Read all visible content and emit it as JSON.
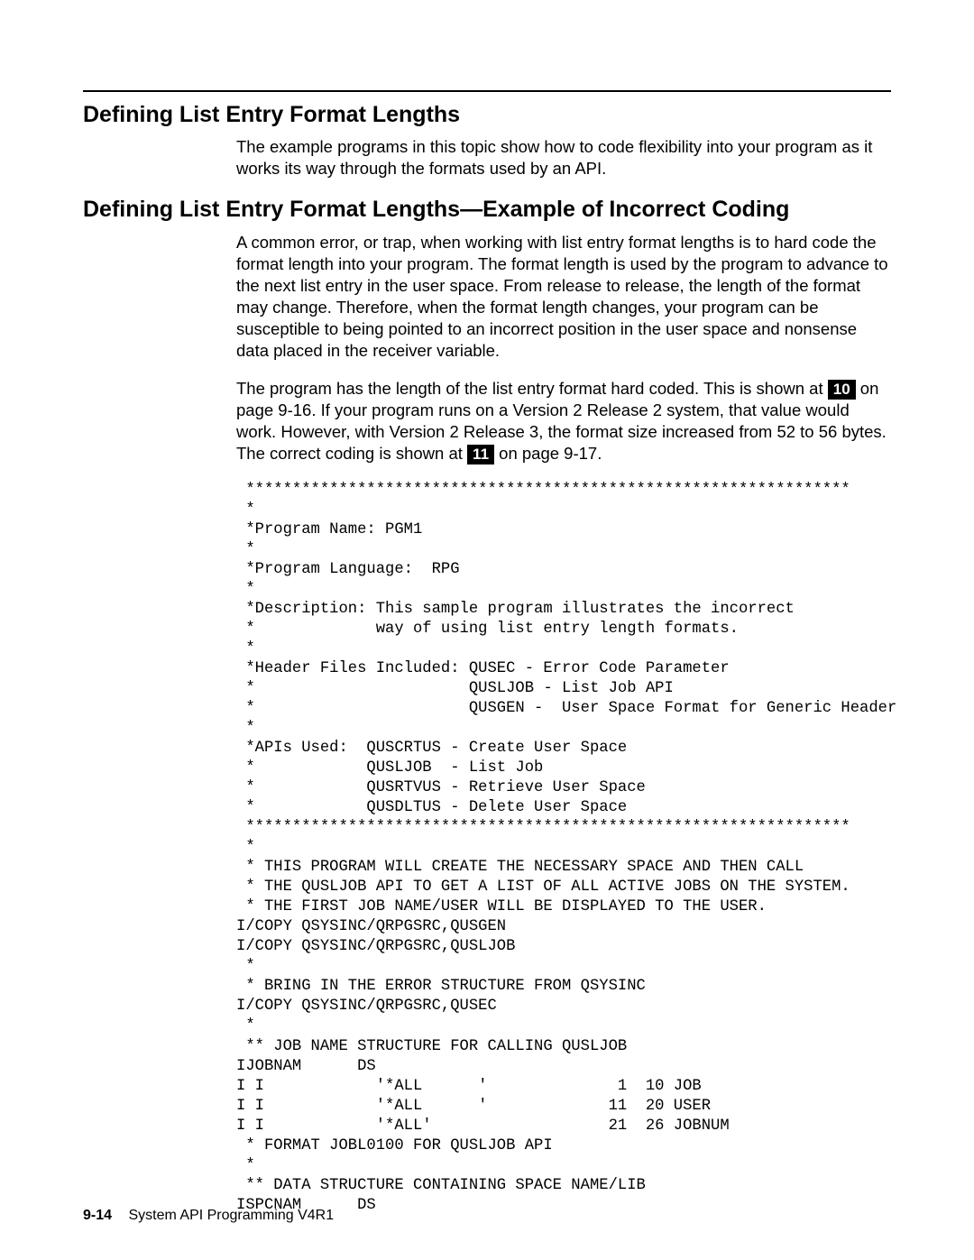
{
  "section1": {
    "heading": "Defining List Entry Format Lengths",
    "para1": "The example programs in this topic show how to code flexibility into your program as it works its way through the formats used by an API."
  },
  "section2": {
    "heading": "Defining List Entry Format Lengths—Example of Incorrect Coding",
    "para1": "A common error, or trap, when working with list entry format lengths is to hard code the format length into your program.  The format length is used by the program to advance to the next list entry in the user space.  From release to release, the length of the format may change.  Therefore, when the format length changes, your program can be susceptible to being pointed to an incorrect position in the user space and nonsense data placed in the receiver variable.",
    "para2_part1": "The program has the length of the list entry format hard coded.  This is shown at ",
    "callout10": "10",
    "para2_part2": " on page 9-16.  If your program runs on a Version 2 Release 2 system, that value would work.  However, with Version 2 Release 3, the format size increased from 52 to 56 bytes.  The correct coding is shown at ",
    "callout11": "11",
    "para2_part3": " on page 9-17."
  },
  "code": " *****************************************************************\n *\n *Program Name: PGM1\n *\n *Program Language:  RPG\n *\n *Description: This sample program illustrates the incorrect\n *             way of using list entry length formats.\n *\n *Header Files Included: QUSEC - Error Code Parameter\n *                       QUSLJOB - List Job API\n *                       QUSGEN -  User Space Format for Generic Header\n *\n *APIs Used:  QUSCRTUS - Create User Space\n *            QUSLJOB  - List Job\n *            QUSRTVUS - Retrieve User Space\n *            QUSDLTUS - Delete User Space\n *****************************************************************\n *\n * THIS PROGRAM WILL CREATE THE NECESSARY SPACE AND THEN CALL\n * THE QUSLJOB API TO GET A LIST OF ALL ACTIVE JOBS ON THE SYSTEM.\n * THE FIRST JOB NAME/USER WILL BE DISPLAYED TO THE USER.\nI/COPY QSYSINC/QRPGSRC,QUSGEN\nI/COPY QSYSINC/QRPGSRC,QUSLJOB\n *\n * BRING IN THE ERROR STRUCTURE FROM QSYSINC\nI/COPY QSYSINC/QRPGSRC,QUSEC\n *\n ** JOB NAME STRUCTURE FOR CALLING QUSLJOB\nIJOBNAM      DS\nI I            '*ALL      '              1  10 JOB\nI I            '*ALL      '             11  20 USER\nI I            '*ALL'                   21  26 JOBNUM\n * FORMAT JOBL0100 FOR QUSLJOB API\n *\n ** DATA STRUCTURE CONTAINING SPACE NAME/LIB\nISPCNAM      DS",
  "footer": {
    "page": "9-14",
    "doc": "System API Programming V4R1"
  }
}
